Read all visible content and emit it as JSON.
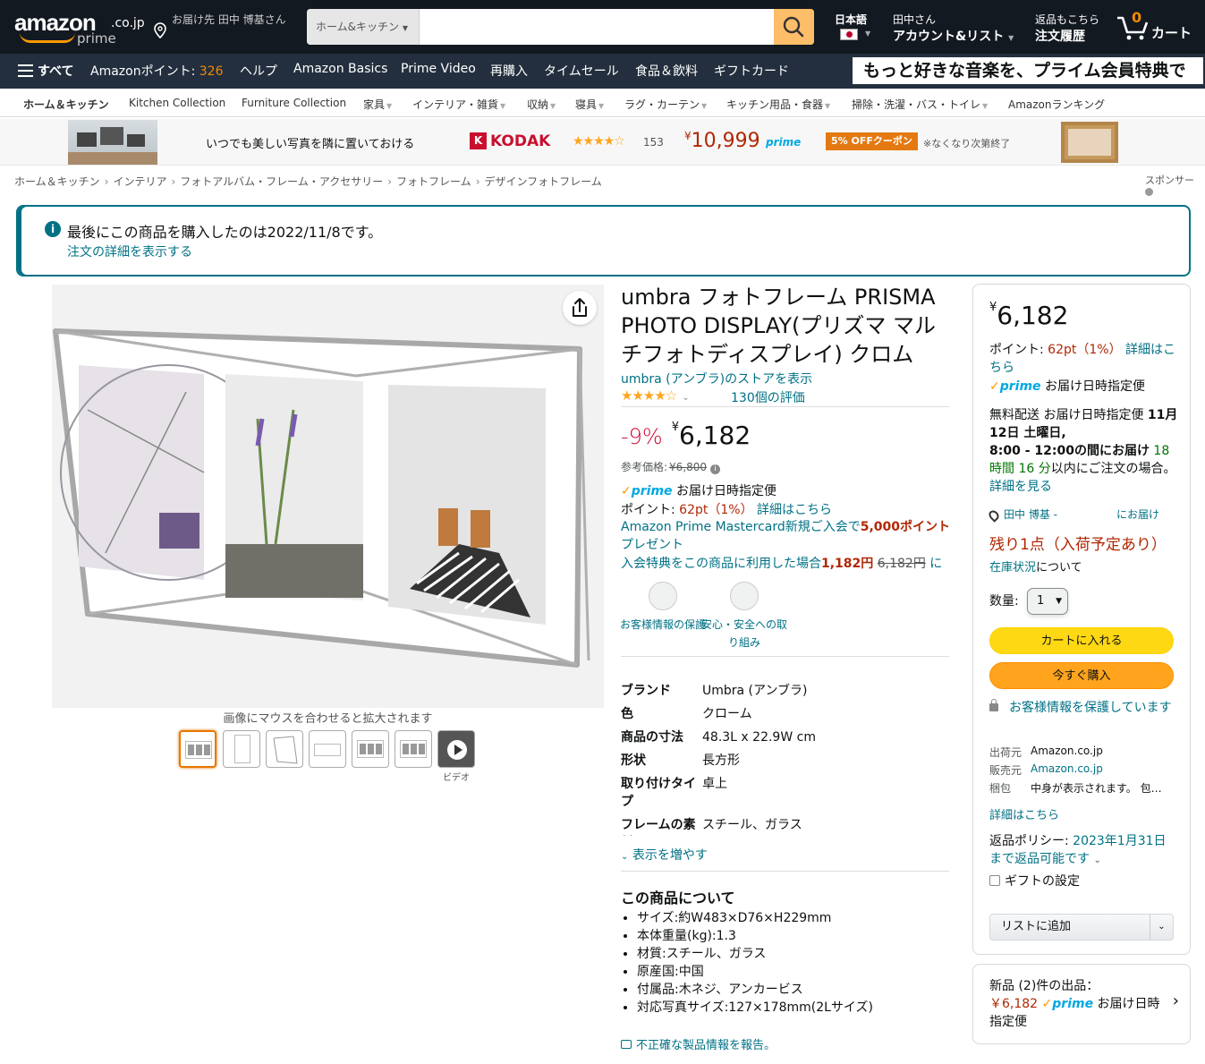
{
  "header": {
    "logo_text": "amazon",
    "logo_domain": ".co.jp",
    "logo_prime": "prime",
    "deliver_to": "お届け先 田中 博基さん",
    "search_category": "ホーム&キッチン",
    "search_value": "",
    "language": "日本語",
    "account_greeting": "田中さん",
    "account_label": "アカウント&リスト",
    "orders_line1": "返品もこちら",
    "orders_line2": "注文履歴",
    "cart_count": "0",
    "cart_label": "カート"
  },
  "nav": {
    "all": "すべて",
    "points_label": "Amazonポイント:",
    "points_value": "326",
    "items": [
      "ヘルプ",
      "Amazon Basics",
      "Prime Video",
      "再購入",
      "タイムセール",
      "食品＆飲料",
      "ギフトカード"
    ],
    "promo": "もっと好きな音楽を、プライム会員特典で"
  },
  "subnav": {
    "items": [
      "ホーム＆キッチン",
      "Kitchen Collection",
      "Furniture Collection",
      "家具",
      "インテリア・雑貨",
      "収納",
      "寝具",
      "ラグ・カーテン",
      "キッチン用品・食器",
      "掃除・洗濯・バス・トイレ",
      "Amazonランキング"
    ]
  },
  "banner": {
    "text": "いつでも美しい写真を隣に置いておける",
    "brand": "KODAK",
    "brand_mark": "K",
    "stars": "★★★★☆",
    "rating_count": "153",
    "price_yen": "¥",
    "price": "10,999",
    "prime": "prime",
    "coupon": "5% OFFクーポン",
    "note": "※なくなり次第終了"
  },
  "breadcrumb": [
    "ホーム＆キッチン",
    "インテリア",
    "フォトアルバム・フレーム・アクセサリー",
    "フォトフレーム",
    "デザインフォトフレーム"
  ],
  "sponsor": "スポンサー",
  "alert": {
    "icon": "i",
    "message": "最後にこの商品を購入したのは2022/11/8です。",
    "link": "注文の詳細を表示する"
  },
  "gallery": {
    "hover_hint": "画像にマウスを合わせると拡大されます",
    "video_label": "ビデオ"
  },
  "product": {
    "title": "umbra フォトフレーム PRISMA PHOTO DISPLAY(プリズマ マルチフォトディスプレイ) クロム",
    "store": "umbra (アンブラ)のストアを表示",
    "stars": "★★★★☆",
    "rating_value": 4.5,
    "rating_count": "130個の評価",
    "discount": "-9%",
    "yen": "¥",
    "price": "6,182",
    "list_price_label": "参考価格:",
    "list_price": "¥6,800",
    "prime_logo": "prime",
    "prime_text": "お届け日時指定便",
    "points_label": "ポイント:",
    "points_value": "62pt（1%）",
    "points_link": "詳細はこちら",
    "mc_text_a": "Amazon Prime Mastercard新規ご入会で",
    "mc_text_b": "5,000ポイント",
    "mc_text_c": "プレゼント",
    "mc2_a": "入会特典をこの商品に利用した場合",
    "mc2_b": "1,182円",
    "mc2_c": "6,182円",
    "mc2_d": "に",
    "trust": [
      "お客様情報の保護",
      "安心・安全への取り組み"
    ],
    "specs": [
      {
        "k": "ブランド",
        "v": "Umbra (アンブラ)"
      },
      {
        "k": "色",
        "v": "クローム"
      },
      {
        "k": "商品の寸法",
        "v": "48.3L x 22.9W cm"
      },
      {
        "k": "形状",
        "v": "長方形"
      },
      {
        "k": "取り付けタイプ",
        "v": "卓上"
      },
      {
        "k": "フレームの素材",
        "v": "スチール、ガラス"
      }
    ],
    "more": "表示を増やす",
    "about_title": "この商品について",
    "bullets": [
      "サイズ:約W483×D76×H229mm",
      "本体重量(kg):1.3",
      "材質:スチール、ガラス",
      "原産国:中国",
      "付属品:木ネジ、アンカービス",
      "対応写真サイズ:127×178mm(2Lサイズ)"
    ],
    "report": "不正確な製品情報を報告。"
  },
  "buybox": {
    "yen": "¥",
    "price": "6,182",
    "points_label": "ポイント:",
    "points_value": "62pt（1%）",
    "points_link": "詳細はこちら",
    "prime_text": "お届け日時指定便",
    "delivery_a": "無料配送 お届け日時指定便",
    "delivery_b": "11月12日 土曜日,",
    "delivery_c": "8:00 - 12:00の間にお届け",
    "delivery_d": "18時間",
    "delivery_e": "16 分",
    "delivery_f": "以内にご注文の場合。",
    "delivery_link": "詳細を見る",
    "address": "田中 博基 -",
    "address_tail": "にお届け",
    "stock": "残り1点（入荷予定あり）",
    "stock_link": "在庫状況",
    "stock_tail": "について",
    "qty_label": "数量:",
    "qty_value": "1",
    "add_to_cart": "カートに入れる",
    "buy_now": "今すぐ購入",
    "secure": "お客様情報を保護しています",
    "ship_from_k": "出荷元",
    "ship_from_v": "Amazon.co.jp",
    "seller_k": "販売元",
    "seller_v": "Amazon.co.jp",
    "pack_k": "梱包",
    "pack_v": "中身が表示されます。 包…",
    "detail_link": "詳細はこちら",
    "return_label": "返品ポリシー:",
    "return_link": "2023年1月31日まで返品可能です",
    "gift": "ギフトの設定",
    "add_list": "リストに追加"
  },
  "new_offers": {
    "label": "新品 (2)件の出品：",
    "price": "￥6,182",
    "prime": "prime",
    "tail": "お届け日時指定便"
  }
}
